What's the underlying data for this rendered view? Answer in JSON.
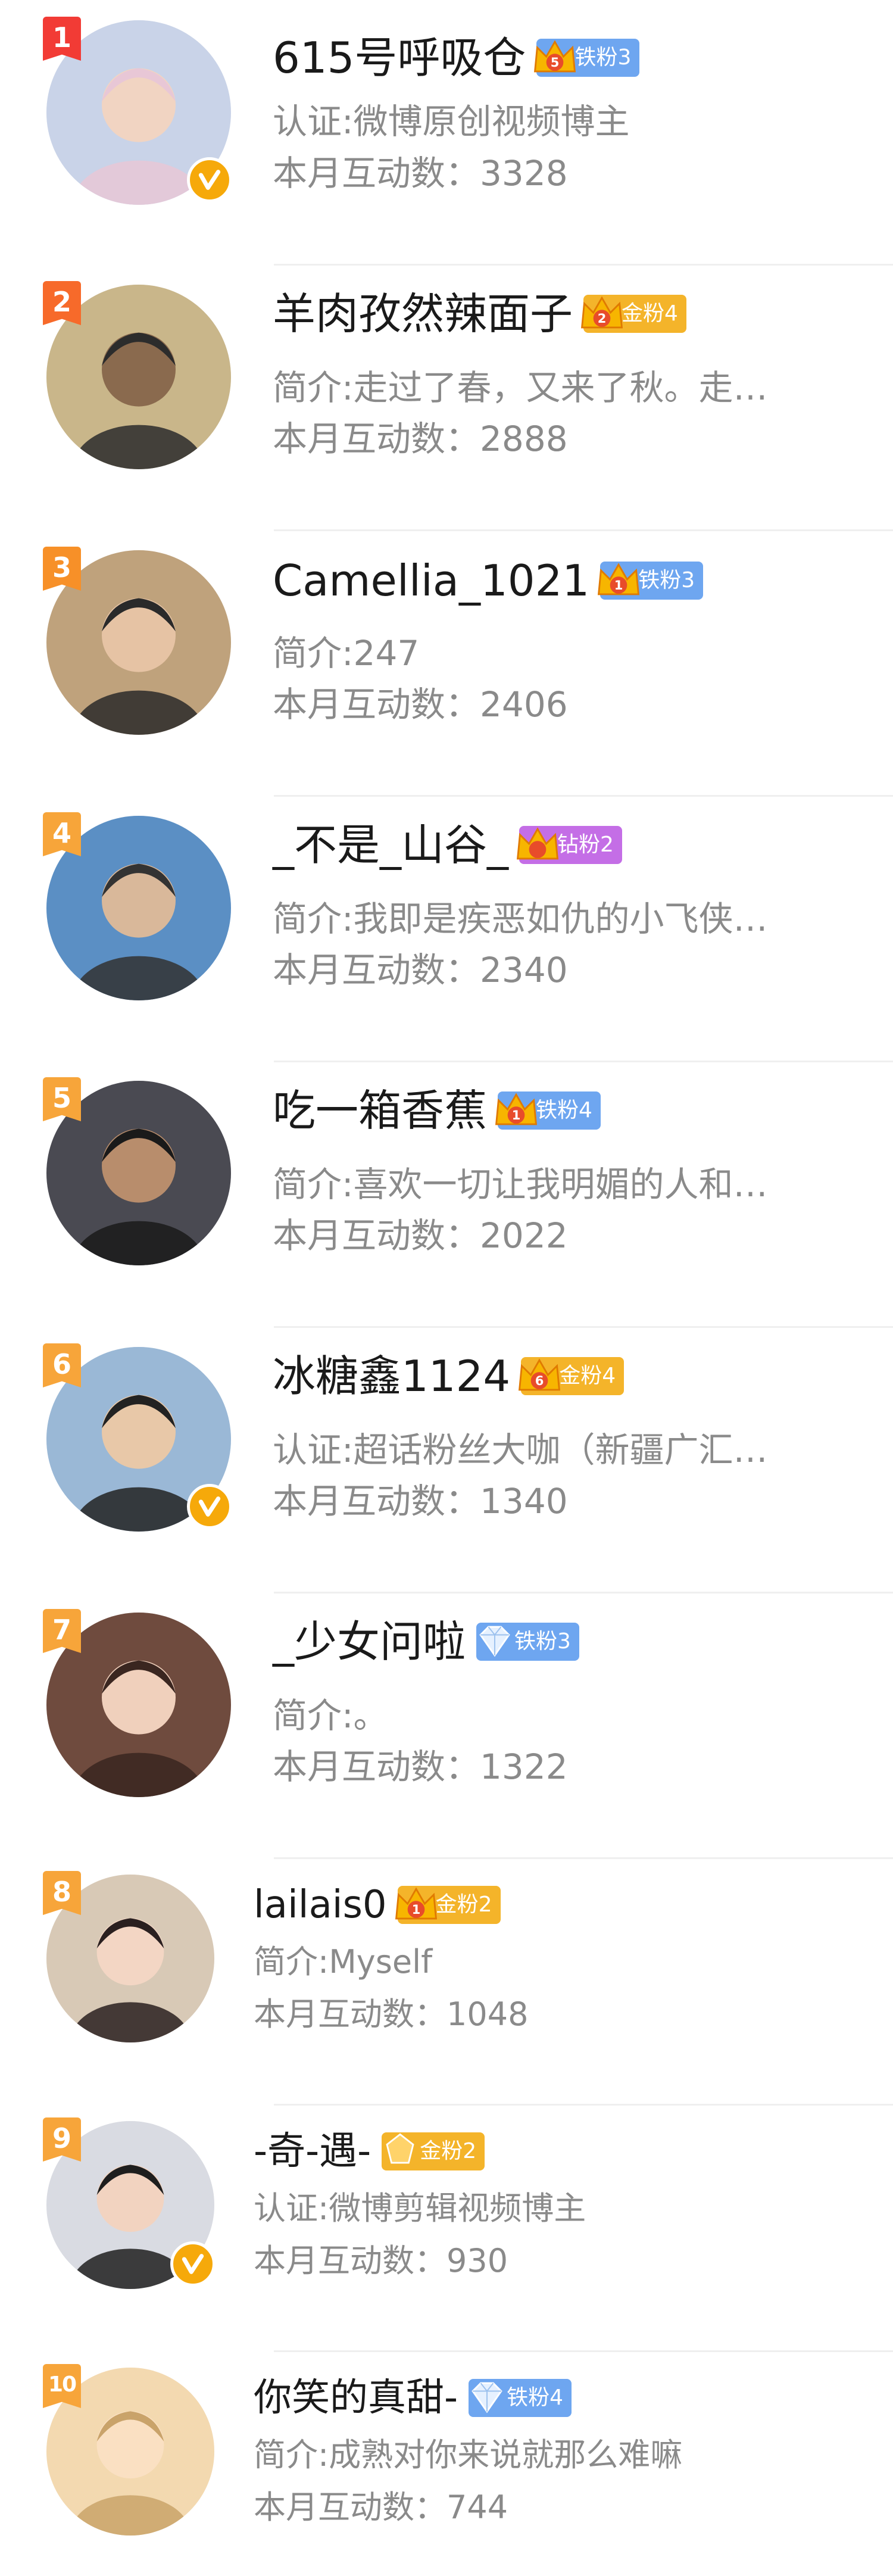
{
  "users": [
    {
      "rank": "1",
      "name": "615号呼吸仓",
      "badge": "铁粉3",
      "badge_type": "iron",
      "badge_level": "5",
      "desc": "认证:微博原创视频博主",
      "stat_label": "本月互动数：",
      "stat_value": "3328",
      "verified": true,
      "rank_color": "#f23b35",
      "avatar_color": "#c9d3e8"
    },
    {
      "rank": "2",
      "name": "羊肉孜然辣面子",
      "badge": "金粉4",
      "badge_type": "gold",
      "badge_level": "2",
      "desc": "简介:走过了春，又来了秋。走…",
      "stat_label": "本月互动数：",
      "stat_value": "2888",
      "verified": false,
      "rank_color": "#f76a2a",
      "avatar_color": "#c9b68a"
    },
    {
      "rank": "3",
      "name": "Camellia_1021",
      "badge": "铁粉3",
      "badge_type": "iron",
      "badge_level": "1",
      "desc": "简介:247",
      "stat_label": "本月互动数：",
      "stat_value": "2406",
      "verified": false,
      "rank_color": "#f79028",
      "avatar_color": "#bfa27c"
    },
    {
      "rank": "4",
      "name": "_不是_山谷_",
      "badge": "钻粉2",
      "badge_type": "diamond",
      "badge_level": "",
      "desc": "简介:我即是疾恶如仇的小飞侠…",
      "stat_label": "本月互动数：",
      "stat_value": "2340",
      "verified": false,
      "rank_color": "#f7a53a",
      "avatar_color": "#5b8fc4"
    },
    {
      "rank": "5",
      "name": "吃一箱香蕉",
      "badge": "铁粉4",
      "badge_type": "iron",
      "badge_level": "1",
      "desc": "简介:喜欢一切让我明媚的人和…",
      "stat_label": "本月互动数：",
      "stat_value": "2022",
      "verified": false,
      "rank_color": "#f7a53a",
      "avatar_color": "#4a4a52"
    },
    {
      "rank": "6",
      "name": "冰糖鑫1124",
      "badge": "金粉4",
      "badge_type": "gold",
      "badge_level": "6",
      "desc": "认证:超话粉丝大咖（新疆广汇…",
      "stat_label": "本月互动数：",
      "stat_value": "1340",
      "verified": true,
      "rank_color": "#f7a53a",
      "avatar_color": "#9ab8d6"
    },
    {
      "rank": "7",
      "name": "_少女问啦",
      "badge": "铁粉3",
      "badge_type": "iron",
      "badge_level": "",
      "desc": "简介:。",
      "stat_label": "本月互动数：",
      "stat_value": "1322",
      "verified": false,
      "rank_color": "#f7a53a",
      "avatar_color": "#6f4b3e"
    },
    {
      "rank": "8",
      "name": "lailais0",
      "badge": "金粉2",
      "badge_type": "gold",
      "badge_level": "1",
      "desc": "简介:Myself",
      "stat_label": "本月互动数：",
      "stat_value": "1048",
      "verified": false,
      "rank_color": "#f7a53a",
      "avatar_color": "#d8c9b6"
    },
    {
      "rank": "9",
      "name": "-奇-遇-",
      "badge": "金粉2",
      "badge_type": "gold",
      "badge_level": "",
      "desc": "认证:微博剪辑视频博主",
      "stat_label": "本月互动数：",
      "stat_value": "930",
      "verified": true,
      "rank_color": "#f7a53a",
      "avatar_color": "#d9dbe2"
    },
    {
      "rank": "10",
      "name": "你笑的真甜-",
      "badge": "铁粉4",
      "badge_type": "iron",
      "badge_level": "",
      "desc": "简介:成熟对你来说就那么难嘛",
      "stat_label": "本月互动数：",
      "stat_value": "744",
      "verified": false,
      "rank_color": "#f7a53a",
      "avatar_color": "#f3d9b0"
    }
  ]
}
